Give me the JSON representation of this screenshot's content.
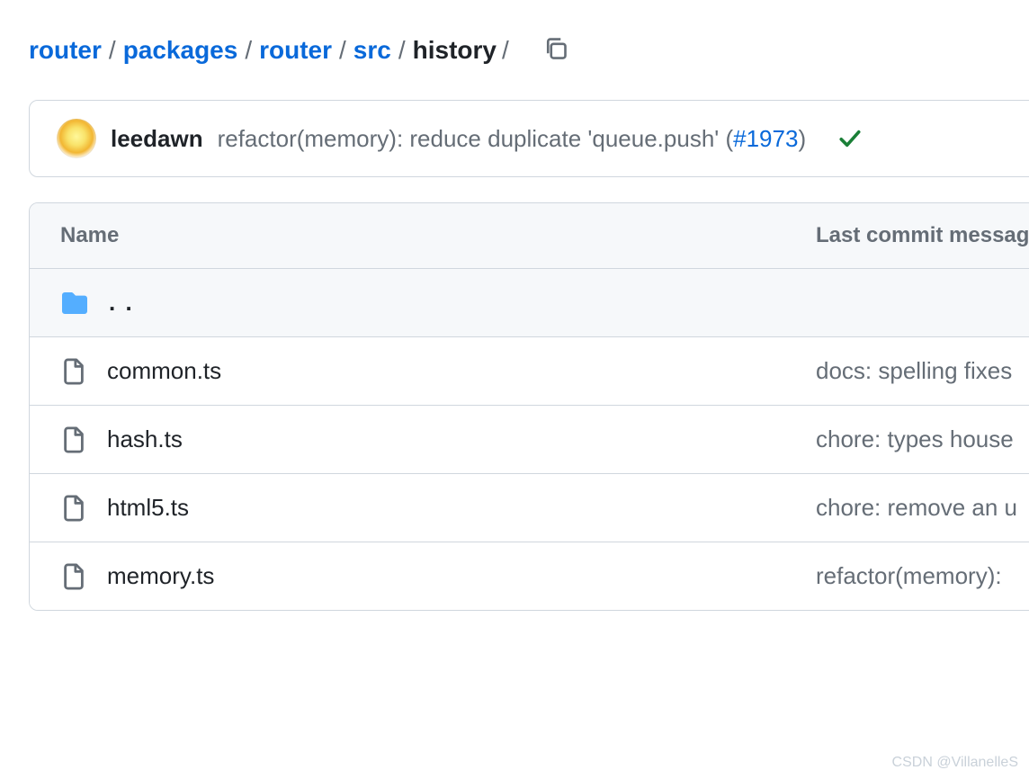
{
  "breadcrumb": {
    "parts": [
      {
        "label": "router",
        "link": true
      },
      {
        "label": "packages",
        "link": true
      },
      {
        "label": "router",
        "link": true
      },
      {
        "label": "src",
        "link": true
      },
      {
        "label": "history",
        "link": false
      }
    ],
    "separator": "/"
  },
  "commit": {
    "author": "leedawn",
    "message_prefix": "refactor(memory): reduce duplicate 'queue.push' (",
    "pr_text": "#1973",
    "message_suffix": ")"
  },
  "table": {
    "header_name": "Name",
    "header_message": "Last commit message",
    "parent_label": ". .",
    "rows": [
      {
        "name": "common.ts",
        "message": "docs: spelling fixes"
      },
      {
        "name": "hash.ts",
        "message": "chore: types house"
      },
      {
        "name": "html5.ts",
        "message": "chore: remove an u"
      },
      {
        "name": "memory.ts",
        "message": "refactor(memory):"
      }
    ]
  },
  "watermark": "CSDN @VillanelleS"
}
